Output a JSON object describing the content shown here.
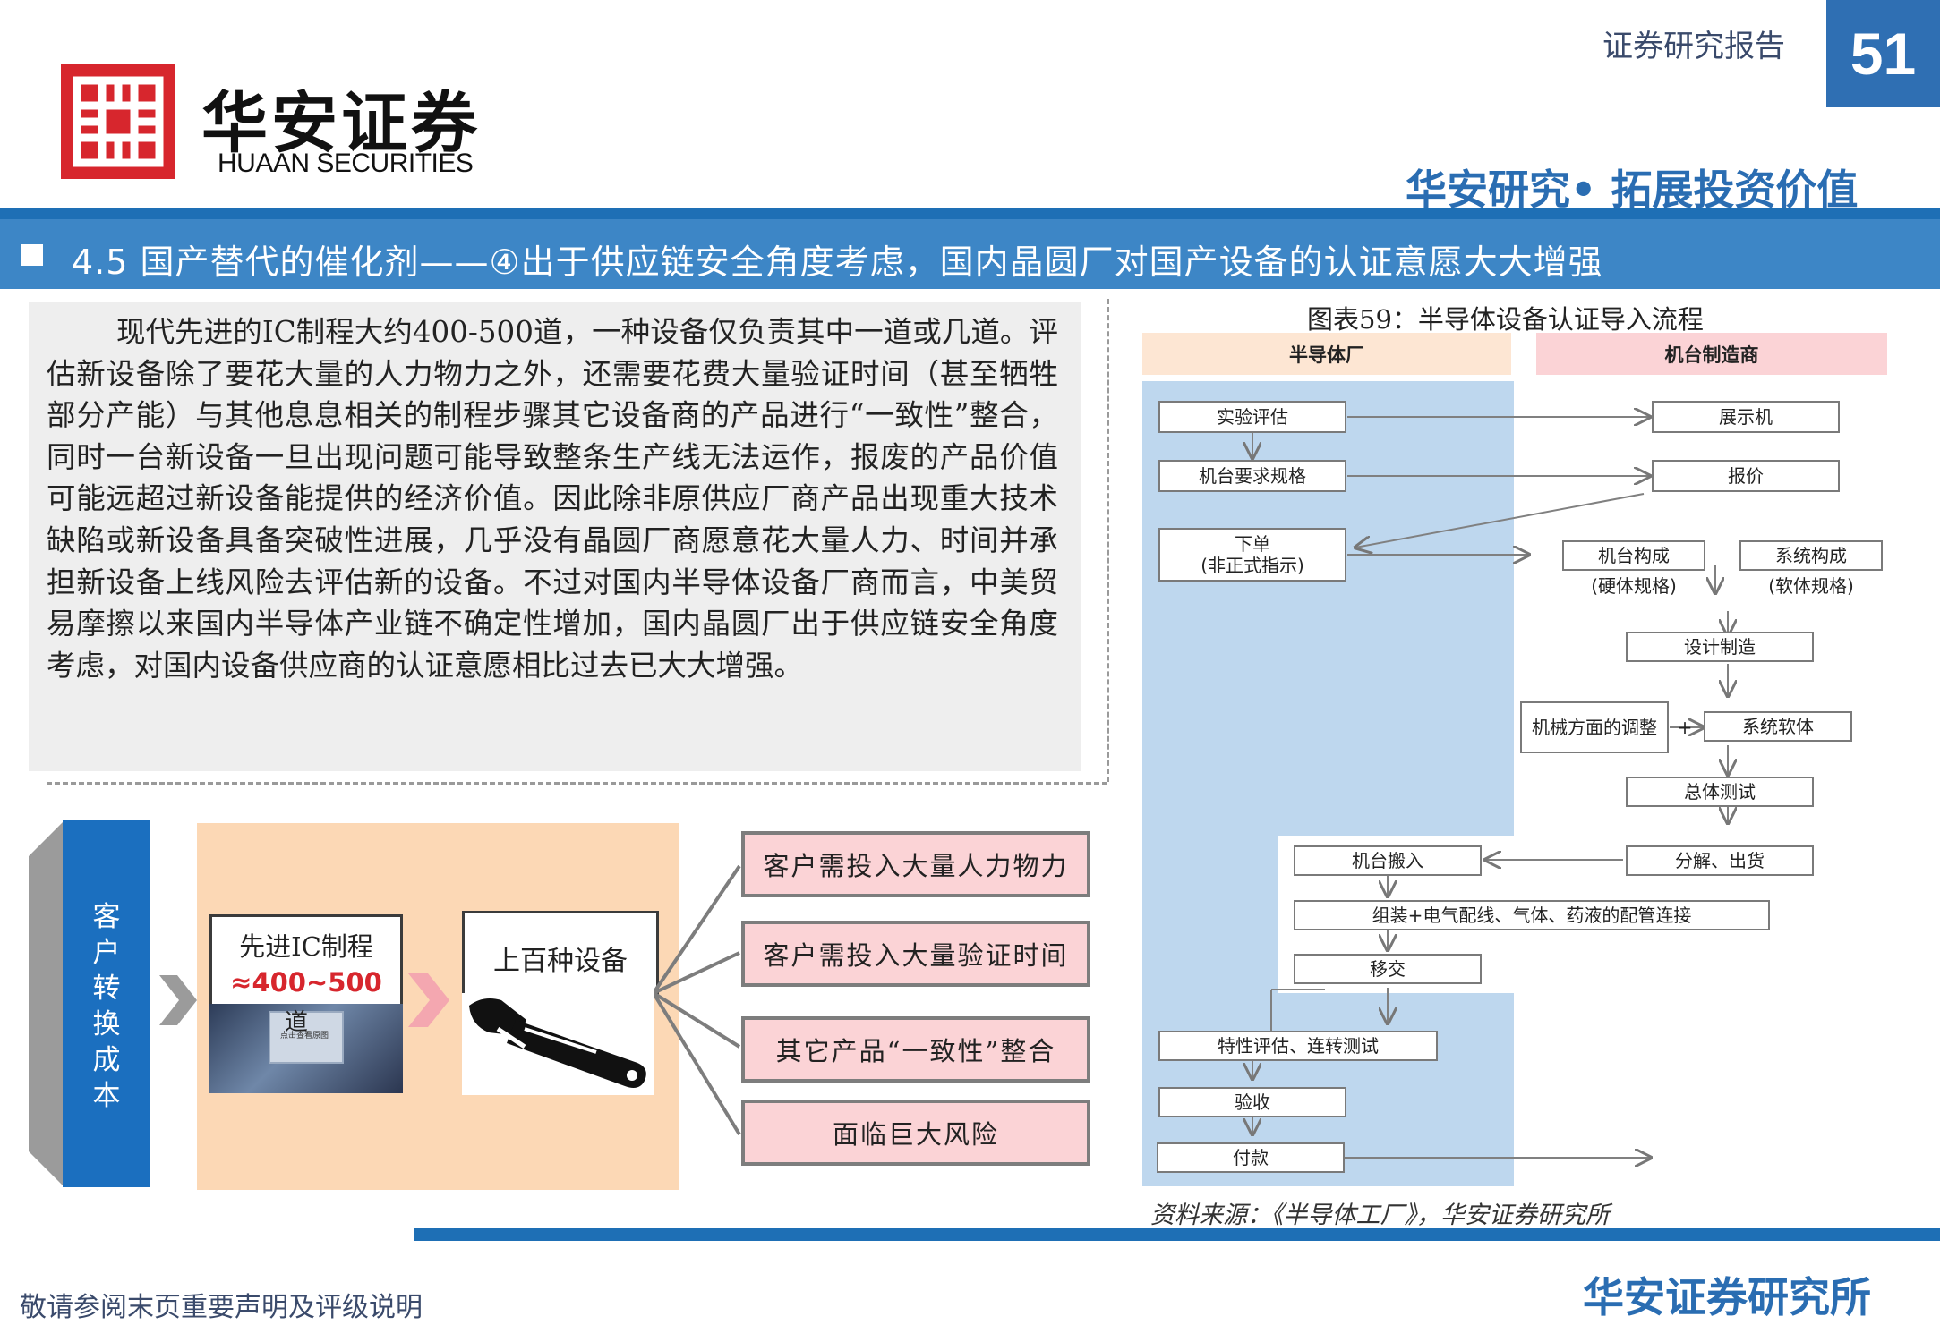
{
  "header": {
    "brand_cn": "华安证券",
    "brand_en": "HUAAN SECURITIES",
    "report_type": "证券研究报告",
    "page_number": "51",
    "slogan": "华安研究• 拓展投资价值"
  },
  "section_title": "4.5  国产替代的催化剂——④出于供应链安全角度考虑，国内晶圆厂对国产设备的认证意愿大大增强",
  "body_text": "现代先进的IC制程大约400-500道，一种设备仅负责其中一道或几道。评估新设备除了要花大量的人力物力之外，还需要花费大量验证时间（甚至牺牲部分产能）与其他息息相关的制程步骤其它设备商的产品进行“一致性”整合，同时一台新设备一旦出现问题可能导致整条生产线无法运作，报废的产品价值可能远超过新设备能提供的经济价值。因此除非原供应厂商产品出现重大技术缺陷或新设备具备突破性进展，几乎没有晶圆厂商愿意花大量人力、时间并承担新设备上线风险去评估新的设备。不过对国内半导体设备厂商而言，中美贸易摩擦以来国内半导体产业链不确定性增加，国内晶圆厂出于供应链安全角度考虑，对国内设备供应商的认证意愿相比过去已大大增强。",
  "cost_diagram": {
    "side_label": "客户转换成本",
    "ic_label": "先进IC制程",
    "ic_value": "≈400~500",
    "ic_value_suffix": "道",
    "ic_chip_caption": "点击查看原图",
    "equipment_label": "上百种设备",
    "outcomes": [
      "客户需投入大量人力物力",
      "客户需投入大量验证时间",
      "其它产品“一致性”整合",
      "面临巨大风险"
    ],
    "colors": {
      "blue": "#1b6fbf",
      "peach": "#fcd8b5",
      "pink": "#fbd3d6",
      "accent_red": "#d7262d"
    }
  },
  "flow_chart": {
    "title": "图表59：半导体设备认证导入流程",
    "lane_fab": "半导体厂",
    "lane_maker": "机台制造商",
    "nodes": {
      "eval": "实验评估",
      "demo": "展示机",
      "spec": "机台要求规格",
      "quote": "报价",
      "order_line1": "下单",
      "order_line2": "(非正式指示)",
      "hw_line1": "机台构成",
      "hw_line2": "(硬体规格)",
      "sw_line1": "系统构成",
      "sw_line2": "(软体规格)",
      "design": "设计制造",
      "mech": "机械方面的调整",
      "plus": "+",
      "software": "系统软体",
      "test": "总体测试",
      "ship": "分解、出货",
      "move_in": "机台搬入",
      "assembly": "组装+电气配线、气体、药液的配管连接",
      "handover": "移交",
      "run_test": "特性评估、连转测试",
      "accept": "验收",
      "pay": "付款"
    },
    "source": "资料来源：《半导体工厂》，华安证券研究所"
  },
  "footer": {
    "disclaimer": "敬请参阅末页重要声明及评级说明",
    "institute": "华安证券研究所"
  },
  "colors": {
    "brand_blue": "#1e6fb5",
    "title_bar": "#3d86c6",
    "logo_red": "#d7262d",
    "lane_pink": "#fbd3d6",
    "lane_peach": "#fde6d3",
    "lane_blue": "#bed7ee"
  }
}
